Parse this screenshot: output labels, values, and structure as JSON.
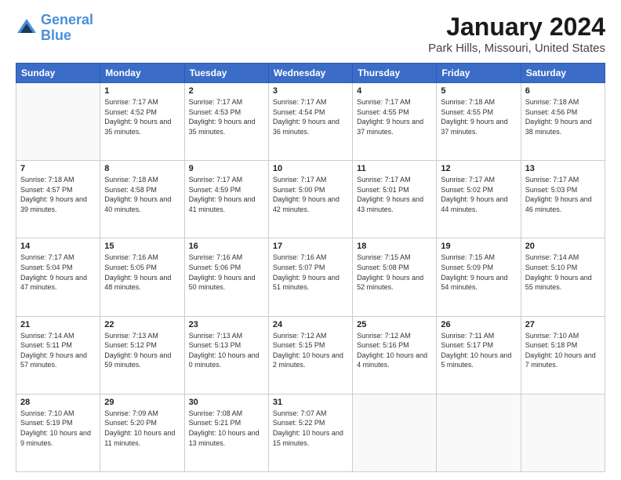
{
  "logo": {
    "line1": "General",
    "line2": "Blue"
  },
  "title": "January 2024",
  "subtitle": "Park Hills, Missouri, United States",
  "weekdays": [
    "Sunday",
    "Monday",
    "Tuesday",
    "Wednesday",
    "Thursday",
    "Friday",
    "Saturday"
  ],
  "weeks": [
    [
      {
        "day": "",
        "sunrise": "",
        "sunset": "",
        "daylight": ""
      },
      {
        "day": "1",
        "sunrise": "Sunrise: 7:17 AM",
        "sunset": "Sunset: 4:52 PM",
        "daylight": "Daylight: 9 hours and 35 minutes."
      },
      {
        "day": "2",
        "sunrise": "Sunrise: 7:17 AM",
        "sunset": "Sunset: 4:53 PM",
        "daylight": "Daylight: 9 hours and 35 minutes."
      },
      {
        "day": "3",
        "sunrise": "Sunrise: 7:17 AM",
        "sunset": "Sunset: 4:54 PM",
        "daylight": "Daylight: 9 hours and 36 minutes."
      },
      {
        "day": "4",
        "sunrise": "Sunrise: 7:17 AM",
        "sunset": "Sunset: 4:55 PM",
        "daylight": "Daylight: 9 hours and 37 minutes."
      },
      {
        "day": "5",
        "sunrise": "Sunrise: 7:18 AM",
        "sunset": "Sunset: 4:55 PM",
        "daylight": "Daylight: 9 hours and 37 minutes."
      },
      {
        "day": "6",
        "sunrise": "Sunrise: 7:18 AM",
        "sunset": "Sunset: 4:56 PM",
        "daylight": "Daylight: 9 hours and 38 minutes."
      }
    ],
    [
      {
        "day": "7",
        "sunrise": "Sunrise: 7:18 AM",
        "sunset": "Sunset: 4:57 PM",
        "daylight": "Daylight: 9 hours and 39 minutes."
      },
      {
        "day": "8",
        "sunrise": "Sunrise: 7:18 AM",
        "sunset": "Sunset: 4:58 PM",
        "daylight": "Daylight: 9 hours and 40 minutes."
      },
      {
        "day": "9",
        "sunrise": "Sunrise: 7:17 AM",
        "sunset": "Sunset: 4:59 PM",
        "daylight": "Daylight: 9 hours and 41 minutes."
      },
      {
        "day": "10",
        "sunrise": "Sunrise: 7:17 AM",
        "sunset": "Sunset: 5:00 PM",
        "daylight": "Daylight: 9 hours and 42 minutes."
      },
      {
        "day": "11",
        "sunrise": "Sunrise: 7:17 AM",
        "sunset": "Sunset: 5:01 PM",
        "daylight": "Daylight: 9 hours and 43 minutes."
      },
      {
        "day": "12",
        "sunrise": "Sunrise: 7:17 AM",
        "sunset": "Sunset: 5:02 PM",
        "daylight": "Daylight: 9 hours and 44 minutes."
      },
      {
        "day": "13",
        "sunrise": "Sunrise: 7:17 AM",
        "sunset": "Sunset: 5:03 PM",
        "daylight": "Daylight: 9 hours and 46 minutes."
      }
    ],
    [
      {
        "day": "14",
        "sunrise": "Sunrise: 7:17 AM",
        "sunset": "Sunset: 5:04 PM",
        "daylight": "Daylight: 9 hours and 47 minutes."
      },
      {
        "day": "15",
        "sunrise": "Sunrise: 7:16 AM",
        "sunset": "Sunset: 5:05 PM",
        "daylight": "Daylight: 9 hours and 48 minutes."
      },
      {
        "day": "16",
        "sunrise": "Sunrise: 7:16 AM",
        "sunset": "Sunset: 5:06 PM",
        "daylight": "Daylight: 9 hours and 50 minutes."
      },
      {
        "day": "17",
        "sunrise": "Sunrise: 7:16 AM",
        "sunset": "Sunset: 5:07 PM",
        "daylight": "Daylight: 9 hours and 51 minutes."
      },
      {
        "day": "18",
        "sunrise": "Sunrise: 7:15 AM",
        "sunset": "Sunset: 5:08 PM",
        "daylight": "Daylight: 9 hours and 52 minutes."
      },
      {
        "day": "19",
        "sunrise": "Sunrise: 7:15 AM",
        "sunset": "Sunset: 5:09 PM",
        "daylight": "Daylight: 9 hours and 54 minutes."
      },
      {
        "day": "20",
        "sunrise": "Sunrise: 7:14 AM",
        "sunset": "Sunset: 5:10 PM",
        "daylight": "Daylight: 9 hours and 55 minutes."
      }
    ],
    [
      {
        "day": "21",
        "sunrise": "Sunrise: 7:14 AM",
        "sunset": "Sunset: 5:11 PM",
        "daylight": "Daylight: 9 hours and 57 minutes."
      },
      {
        "day": "22",
        "sunrise": "Sunrise: 7:13 AM",
        "sunset": "Sunset: 5:12 PM",
        "daylight": "Daylight: 9 hours and 59 minutes."
      },
      {
        "day": "23",
        "sunrise": "Sunrise: 7:13 AM",
        "sunset": "Sunset: 5:13 PM",
        "daylight": "Daylight: 10 hours and 0 minutes."
      },
      {
        "day": "24",
        "sunrise": "Sunrise: 7:12 AM",
        "sunset": "Sunset: 5:15 PM",
        "daylight": "Daylight: 10 hours and 2 minutes."
      },
      {
        "day": "25",
        "sunrise": "Sunrise: 7:12 AM",
        "sunset": "Sunset: 5:16 PM",
        "daylight": "Daylight: 10 hours and 4 minutes."
      },
      {
        "day": "26",
        "sunrise": "Sunrise: 7:11 AM",
        "sunset": "Sunset: 5:17 PM",
        "daylight": "Daylight: 10 hours and 5 minutes."
      },
      {
        "day": "27",
        "sunrise": "Sunrise: 7:10 AM",
        "sunset": "Sunset: 5:18 PM",
        "daylight": "Daylight: 10 hours and 7 minutes."
      }
    ],
    [
      {
        "day": "28",
        "sunrise": "Sunrise: 7:10 AM",
        "sunset": "Sunset: 5:19 PM",
        "daylight": "Daylight: 10 hours and 9 minutes."
      },
      {
        "day": "29",
        "sunrise": "Sunrise: 7:09 AM",
        "sunset": "Sunset: 5:20 PM",
        "daylight": "Daylight: 10 hours and 11 minutes."
      },
      {
        "day": "30",
        "sunrise": "Sunrise: 7:08 AM",
        "sunset": "Sunset: 5:21 PM",
        "daylight": "Daylight: 10 hours and 13 minutes."
      },
      {
        "day": "31",
        "sunrise": "Sunrise: 7:07 AM",
        "sunset": "Sunset: 5:22 PM",
        "daylight": "Daylight: 10 hours and 15 minutes."
      },
      {
        "day": "",
        "sunrise": "",
        "sunset": "",
        "daylight": ""
      },
      {
        "day": "",
        "sunrise": "",
        "sunset": "",
        "daylight": ""
      },
      {
        "day": "",
        "sunrise": "",
        "sunset": "",
        "daylight": ""
      }
    ]
  ]
}
